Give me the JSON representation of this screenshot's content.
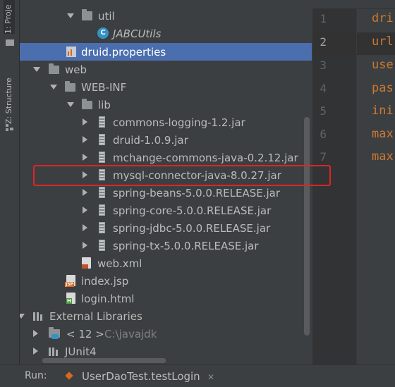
{
  "tool_strip": {
    "project_tab": "1: Proje",
    "structure_tab": "Z: Structure"
  },
  "tree": {
    "util": "util",
    "jabcutils": "JABCUtils",
    "druid_properties": "druid.properties",
    "web": "web",
    "web_inf": "WEB-INF",
    "lib": "lib",
    "jars": [
      "commons-logging-1.2.jar",
      "druid-1.0.9.jar",
      "mchange-commons-java-0.2.12.jar",
      "mysql-connector-java-8.0.27.jar",
      "spring-beans-5.0.0.RELEASE.jar",
      "spring-core-5.0.0.RELEASE.jar",
      "spring-jdbc-5.0.0.RELEASE.jar",
      "spring-tx-5.0.0.RELEASE.jar"
    ],
    "web_xml": "web.xml",
    "index_jsp": "index.jsp",
    "login_html": "login.html",
    "external_libraries": "External Libraries",
    "jdk_label": "< 12 >",
    "jdk_path": "C:\\javajdk",
    "junit": "JUnit4"
  },
  "editor": {
    "line_numbers": [
      "1",
      "2",
      "3",
      "4",
      "5",
      "6",
      "7"
    ],
    "lines": [
      "dri",
      "url",
      "use",
      "pas",
      "ini",
      "max",
      "max"
    ]
  },
  "run_bar": {
    "label": "Run:",
    "config": "UserDaoTest.testLogin"
  },
  "colors": {
    "selection": "#4b6eaf",
    "highlight_box": "#e02424",
    "keyword": "#cc7832"
  }
}
